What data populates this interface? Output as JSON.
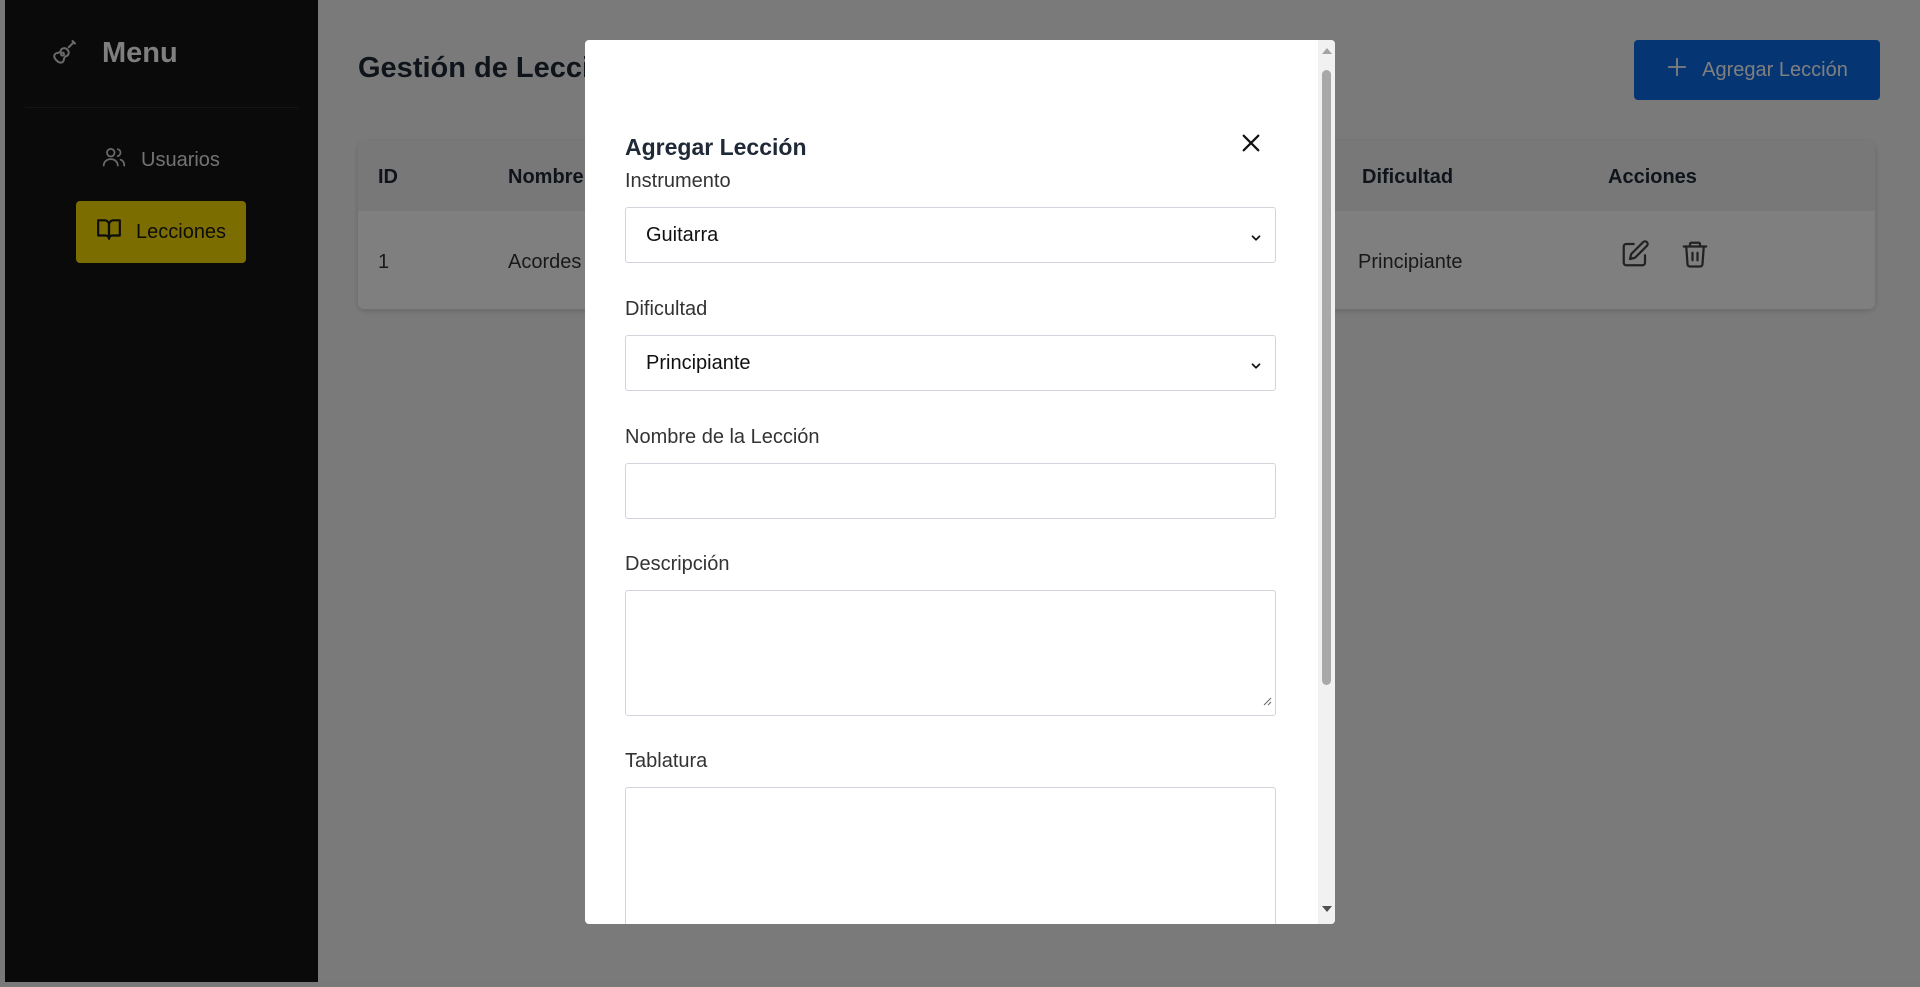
{
  "sidebar": {
    "title": "Menu",
    "logo_icon": "guitar-icon",
    "items": [
      {
        "label": "Usuarios",
        "icon": "users-icon",
        "active": false
      },
      {
        "label": "Lecciones",
        "icon": "book-icon",
        "active": true
      }
    ]
  },
  "main": {
    "title": "Gestión de Lecciones",
    "add_button_label": "Agregar Lección",
    "table": {
      "headers": [
        "ID",
        "Nombre",
        "Dificultad",
        "Acciones"
      ],
      "rows": [
        {
          "id": "1",
          "nombre": "Acordes",
          "dificultad": "Principiante"
        }
      ]
    }
  },
  "modal": {
    "title": "Agregar Lección",
    "fields": {
      "instrumento": {
        "label": "Instrumento",
        "value": "Guitarra"
      },
      "dificultad": {
        "label": "Dificultad",
        "value": "Principiante"
      },
      "nombre": {
        "label": "Nombre de la Lección",
        "value": ""
      },
      "descripcion": {
        "label": "Descripción",
        "value": ""
      },
      "tablatura": {
        "label": "Tablatura",
        "value": ""
      }
    }
  },
  "colors": {
    "sidebar_bg": "#141414",
    "active_item": "#f7da00",
    "primary_button": "#0a6be6",
    "overlay": "rgba(0,0,0,0.5)"
  }
}
